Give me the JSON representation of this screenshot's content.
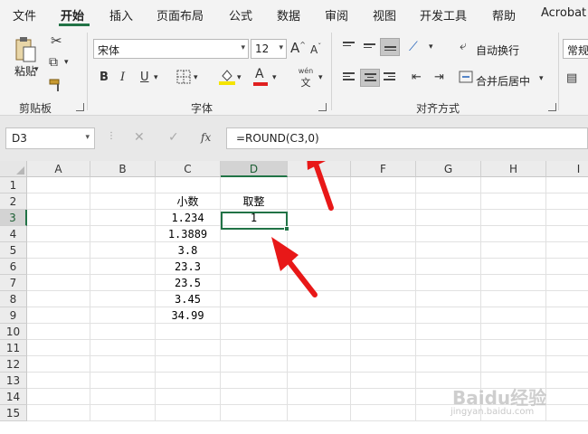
{
  "tabs": [
    "文件",
    "开始",
    "插入",
    "页面布局",
    "公式",
    "数据",
    "审阅",
    "视图",
    "开发工具",
    "帮助",
    "Acrobat"
  ],
  "ribbon": {
    "clipboard": {
      "paste_label": "粘贴",
      "group_label": "剪贴板"
    },
    "font": {
      "font_name": "宋体",
      "font_size": "12",
      "bold": "B",
      "italic": "I",
      "underline": "U",
      "grow": "A",
      "shrink": "A",
      "phonetic": "wén",
      "phonetic_char": "文",
      "font_color_letter": "A",
      "group_label": "字体"
    },
    "alignment": {
      "wrap_label": "自动换行",
      "merge_label": "合并后居中",
      "group_label": "对齐方式"
    },
    "number": {
      "format": "常规"
    }
  },
  "formula_bar": {
    "name_box": "D3",
    "cancel": "✕",
    "confirm": "✓",
    "fx": "fx",
    "formula": "=ROUND(C3,0)"
  },
  "grid": {
    "columns": [
      "A",
      "B",
      "C",
      "D",
      "F",
      "G",
      "H",
      "I"
    ],
    "rows": [
      "1",
      "2",
      "3",
      "4",
      "5",
      "6",
      "7",
      "8",
      "9",
      "10",
      "11",
      "12",
      "13",
      "14",
      "15"
    ],
    "selected_cell": "D3",
    "cells": {
      "C2": "小数",
      "D2": "取整",
      "C3": "1.234",
      "D3": "1",
      "C4": "1.3889",
      "C5": "3.8",
      "C6": "23.3",
      "C7": "23.5",
      "C8": "3.45",
      "C9": "34.99"
    }
  },
  "watermark": {
    "text": "Baidu经验",
    "sub": "jingyan.baidu.com"
  },
  "colors": {
    "accent": "#217346",
    "arrow": "#e81818",
    "font_color_bar": "#e02020",
    "highlight_bar": "#f5e400"
  }
}
